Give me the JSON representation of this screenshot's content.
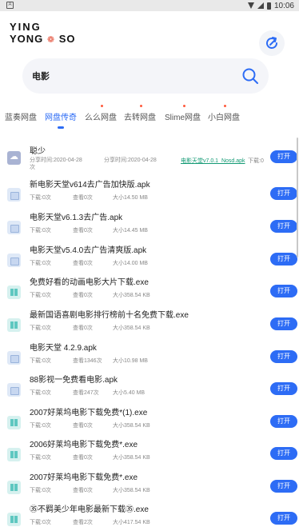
{
  "status_bar": {
    "notif_glyph": "A",
    "time": "10:06"
  },
  "logo": {
    "line1": "YING",
    "line2a": "YONG",
    "line2b": "SO",
    "mark": "❁"
  },
  "search": {
    "query": "电影"
  },
  "tabs": [
    {
      "label": "蓝奏网盘",
      "active": false
    },
    {
      "label": "网盘传奇",
      "active": true
    },
    {
      "label": "么么网盘",
      "active": false
    },
    {
      "label": "去转网盘",
      "active": false
    },
    {
      "label": "Slime网盘",
      "active": false
    },
    {
      "label": "小白网盘",
      "active": false
    }
  ],
  "open_label": "打开",
  "items": [
    {
      "type": "folder",
      "title": "聪少",
      "m1": "分享时间:2020-04-28",
      "m1b": "次",
      "m2": "分享时间:2020-04-28",
      "link": "电影天堂v7.0.1_Nosd.apk",
      "m3": "下载:0"
    },
    {
      "type": "apk",
      "title": "新电影天堂v614去广告加快版.apk",
      "m1": "下载:0次",
      "m2": "查看0次",
      "m3": "大小14.50 MB"
    },
    {
      "type": "apk",
      "title": "电影天堂v6.1.3去广告.apk",
      "m1": "下载:0次",
      "m2": "查看0次",
      "m3": "大小14.45 MB"
    },
    {
      "type": "apk",
      "title": "电影天堂v5.4.0去广告清爽版.apk",
      "m1": "下载:0次",
      "m2": "查看0次",
      "m3": "大小14.00 MB"
    },
    {
      "type": "exe",
      "title": "免费好看的动画电影大片下载.exe",
      "m1": "下载:0次",
      "m2": "查看0次",
      "m3": "大小358.54 KB"
    },
    {
      "type": "exe",
      "title": "最新国语喜剧电影排行榜前十名免费下载.exe",
      "m1": "下载:0次",
      "m2": "查看0次",
      "m3": "大小358.54 KB"
    },
    {
      "type": "apk",
      "title": "电影天堂 4.2.9.apk",
      "m1": "下载:0次",
      "m2": "查看1346次",
      "m3": "大小10.98 MB"
    },
    {
      "type": "apk",
      "title": "88影视一免费看电影.apk",
      "m1": "下载:0次",
      "m2": "查看247次",
      "m3": "大小5.40 MB"
    },
    {
      "type": "exe",
      "title": "2007好莱坞电影下载免费*(1).exe",
      "m1": "下载:0次",
      "m2": "查看0次",
      "m3": "大小358.54 KB"
    },
    {
      "type": "exe",
      "title": "2006好莱坞电影下载免费*.exe",
      "m1": "下载:0次",
      "m2": "查看0次",
      "m3": "大小358.54 KB"
    },
    {
      "type": "exe",
      "title": "2007好莱坞电影下载免费*.exe",
      "m1": "下载:0次",
      "m2": "查看0次",
      "m3": "大小358.54 KB"
    },
    {
      "type": "exe",
      "title": "㉟不羁美少年电影最新下载㉟.exe",
      "m1": "下载:0次",
      "m2": "查看2次",
      "m3": "大小417.54 KB"
    }
  ]
}
